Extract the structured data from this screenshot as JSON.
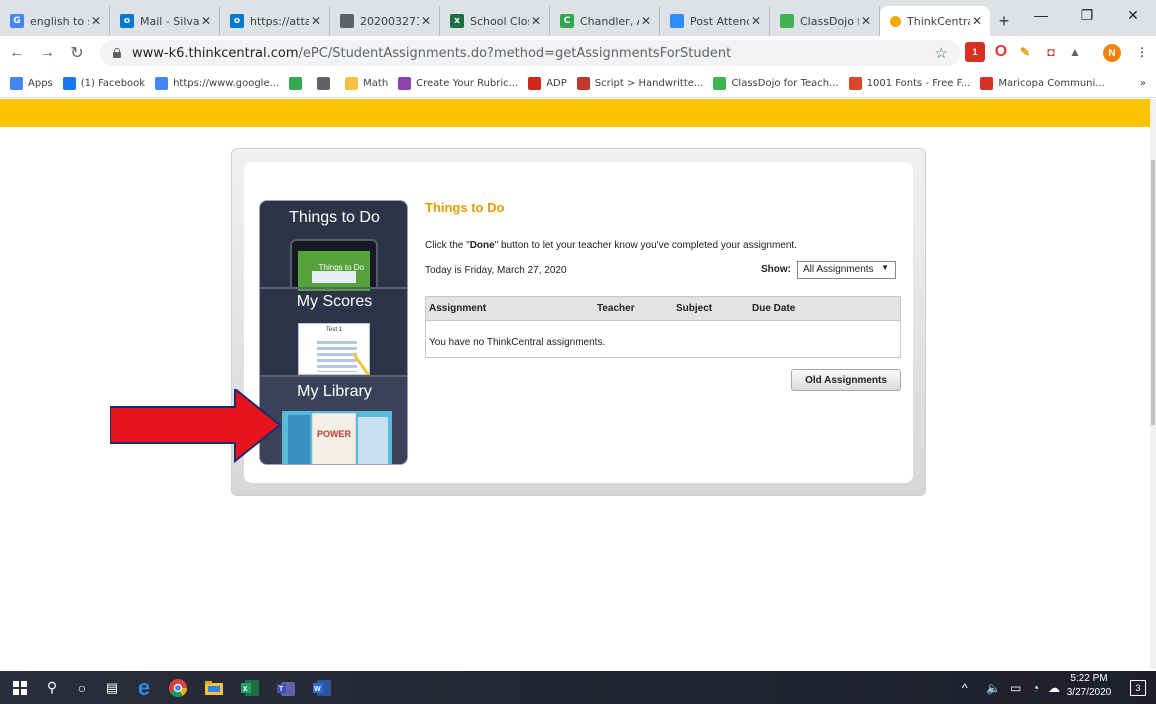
{
  "browser": {
    "tabs": [
      {
        "title": "english to s",
        "icon_letter": "G",
        "icon_color": "#4285f4"
      },
      {
        "title": "Mail - Silva,",
        "icon_letter": "o",
        "icon_color": "#0078d4"
      },
      {
        "title": "https://atta",
        "icon_letter": "o",
        "icon_color": "#0078d4"
      },
      {
        "title": "202003271",
        "icon_letter": "",
        "icon_color": "#5f6368"
      },
      {
        "title": "School Clos",
        "icon_letter": "x",
        "icon_color": "#1d6f42"
      },
      {
        "title": "Chandler, A",
        "icon_letter": "C",
        "icon_color": "#2fa84f"
      },
      {
        "title": "Post Attend",
        "icon_letter": "",
        "icon_color": "#2d8cff"
      },
      {
        "title": "ClassDojo f",
        "icon_letter": "",
        "icon_color": "#3fb34f"
      },
      {
        "title": "ThinkCentra",
        "icon_letter": "",
        "icon_color": "#f2a900",
        "active": true
      }
    ],
    "url_host": "www-k6.thinkcentral.com",
    "url_path": "/ePC/StudentAssignments.do?method=getAssignmentsForStudent",
    "profile_initial": "N",
    "bookmarks": [
      {
        "label": "Apps",
        "icon": "apps-grid-icon",
        "color": "#4285f4"
      },
      {
        "label": "(1) Facebook",
        "icon": "facebook-icon",
        "color": "#1877f2"
      },
      {
        "label": "https://www.google...",
        "icon": "google-icon",
        "color": "#4285f4"
      },
      {
        "label": "",
        "icon": "drive-icon",
        "color": "#34a853"
      },
      {
        "label": "",
        "icon": "chrome-icon",
        "color": "#5f6368"
      },
      {
        "label": "Math",
        "icon": "folder-icon",
        "color": "#f5c342"
      },
      {
        "label": "Create Your Rubric...",
        "icon": "rubric-icon",
        "color": "#8e44ad"
      },
      {
        "label": "ADP",
        "icon": "adp-icon",
        "color": "#d0271d"
      },
      {
        "label": "Script > Handwritte...",
        "icon": "script-icon",
        "color": "#c0392b"
      },
      {
        "label": "ClassDojo for Teach...",
        "icon": "classdojo-icon",
        "color": "#3fb34f"
      },
      {
        "label": "1001 Fonts - Free F...",
        "icon": "fonts-icon",
        "color": "#d9472b"
      },
      {
        "label": "Maricopa Communi...",
        "icon": "gmail-icon",
        "color": "#d93025"
      }
    ],
    "bookmarks_overflow": "»"
  },
  "sidebar": {
    "items": [
      {
        "label": "Things to Do",
        "thumb_text": "Things to Do"
      },
      {
        "label": "My Scores",
        "thumb_text": "Test 1"
      },
      {
        "label": "My Library",
        "thumb_text": "POWER"
      }
    ]
  },
  "main": {
    "title": "Things to Do",
    "instruction_pre": "Click the \"",
    "instruction_done": "Done",
    "instruction_post": "\" button to let your teacher know you've completed your assignment.",
    "today": "Today is Friday, March 27, 2020",
    "show_label": "Show:",
    "show_value": "All Assignments",
    "columns": [
      "Assignment",
      "Teacher",
      "Subject",
      "Due Date"
    ],
    "empty_message": "You have no ThinkCentral assignments.",
    "old_assignments_label": "Old Assignments"
  },
  "colors": {
    "header_bar": "#fcc400",
    "title_accent": "#e89b00",
    "nav_panel": "#2d3447",
    "annotation_arrow": "#e8141c"
  },
  "taskbar": {
    "time": "5:22 PM",
    "date": "3/27/2020",
    "notification_count": "3"
  }
}
